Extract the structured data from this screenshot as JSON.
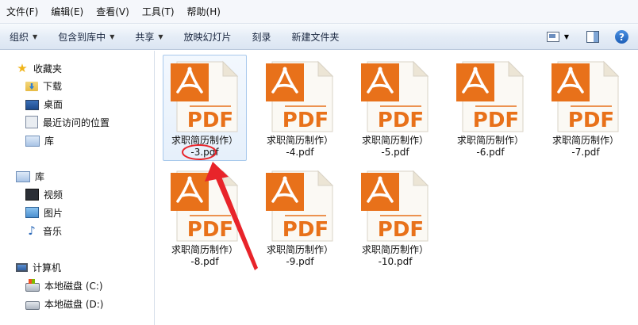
{
  "menu": [
    "文件(F)",
    "编辑(E)",
    "查看(V)",
    "工具(T)",
    "帮助(H)"
  ],
  "toolbar": {
    "organize": "组织",
    "include_library": "包含到库中",
    "share": "共享",
    "slideshow": "放映幻灯片",
    "burn": "刻录",
    "new_folder": "新建文件夹",
    "help": "?"
  },
  "nav": {
    "favorites": {
      "label": "收藏夹",
      "items": [
        "下载",
        "桌面",
        "最近访问的位置",
        "库"
      ]
    },
    "libraries": {
      "label": "库",
      "items": [
        "视频",
        "图片",
        "音乐"
      ]
    },
    "computer": {
      "label": "计算机",
      "items": [
        "本地磁盘 (C:)",
        "本地磁盘 (D:)"
      ]
    }
  },
  "pdf_icon_text": "PDF",
  "files": [
    {
      "line1": "求职简历制作）",
      "line2": "-3.pdf"
    },
    {
      "line1": "求职简历制作）",
      "line2": "-4.pdf"
    },
    {
      "line1": "求职简历制作）",
      "line2": "-5.pdf"
    },
    {
      "line1": "求职简历制作）",
      "line2": "-6.pdf"
    },
    {
      "line1": "求职简历制作）",
      "line2": "-7.pdf"
    },
    {
      "line1": "求职简历制作）",
      "line2": "-8.pdf"
    },
    {
      "line1": "求职简历制作）",
      "line2": "-9.pdf"
    },
    {
      "line1": "求职简历制作）",
      "line2": "-10.pdf"
    }
  ],
  "colors": {
    "pdf_orange": "#e8711a",
    "annotation_red": "#e8242a",
    "selection_border": "#a8c9ec"
  }
}
